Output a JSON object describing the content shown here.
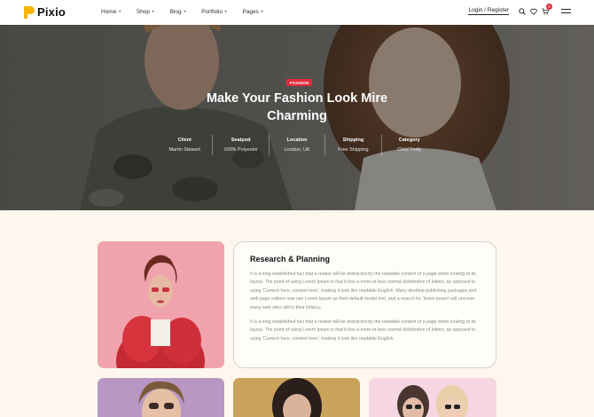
{
  "brand": {
    "name": "Pixio",
    "accent": "#f7b500"
  },
  "nav": [
    {
      "label": "Home",
      "icon": "plus-icon"
    },
    {
      "label": "Shop",
      "icon": "plus-icon"
    },
    {
      "label": "Blog",
      "icon": "plus-icon"
    },
    {
      "label": "Portfolio",
      "icon": "plus-icon"
    },
    {
      "label": "Pages",
      "icon": "plus-icon"
    }
  ],
  "header": {
    "login_label": "Login / Register",
    "cart_count": "0",
    "icons": [
      "search-icon",
      "heart-icon",
      "cart-icon",
      "menu-icon"
    ]
  },
  "hero": {
    "badge": "FASHION",
    "badge_color": "#e02b3d",
    "title": "Make Your Fashion Look Mire Charming",
    "meta": [
      {
        "label": "Client",
        "value": "Martin Stewart"
      },
      {
        "label": "Seatpod",
        "value": "100% Polyester"
      },
      {
        "label": "Location",
        "value": "London, UK"
      },
      {
        "label": "Shipping",
        "value": "Free Shipping"
      },
      {
        "label": "Category",
        "value": "Child Trolly"
      }
    ]
  },
  "project": {
    "title": "Research & Planning",
    "paragraphs": [
      "It is a long established fact that a reader will be distracted by the readable content of a page when looking at its layout. The point of using Lorem Ipsum is that it has a more-or-less normal distribution of letters, as opposed to using 'Content here, content here', making it look like readable English. Many desktop publishing packages and web page editors now use Lorem Ipsum as their default model text, and a search for 'lorem ipsum' will uncover many web sites still in their infancy.",
      "It is a long established fact that a reader will be distracted by the readable content of a page when looking at its layout. The point of using Lorem Ipsum is that it has a more-or-less normal distribution of letters, as opposed to using 'Content here, content here', making it look like readable English."
    ]
  }
}
